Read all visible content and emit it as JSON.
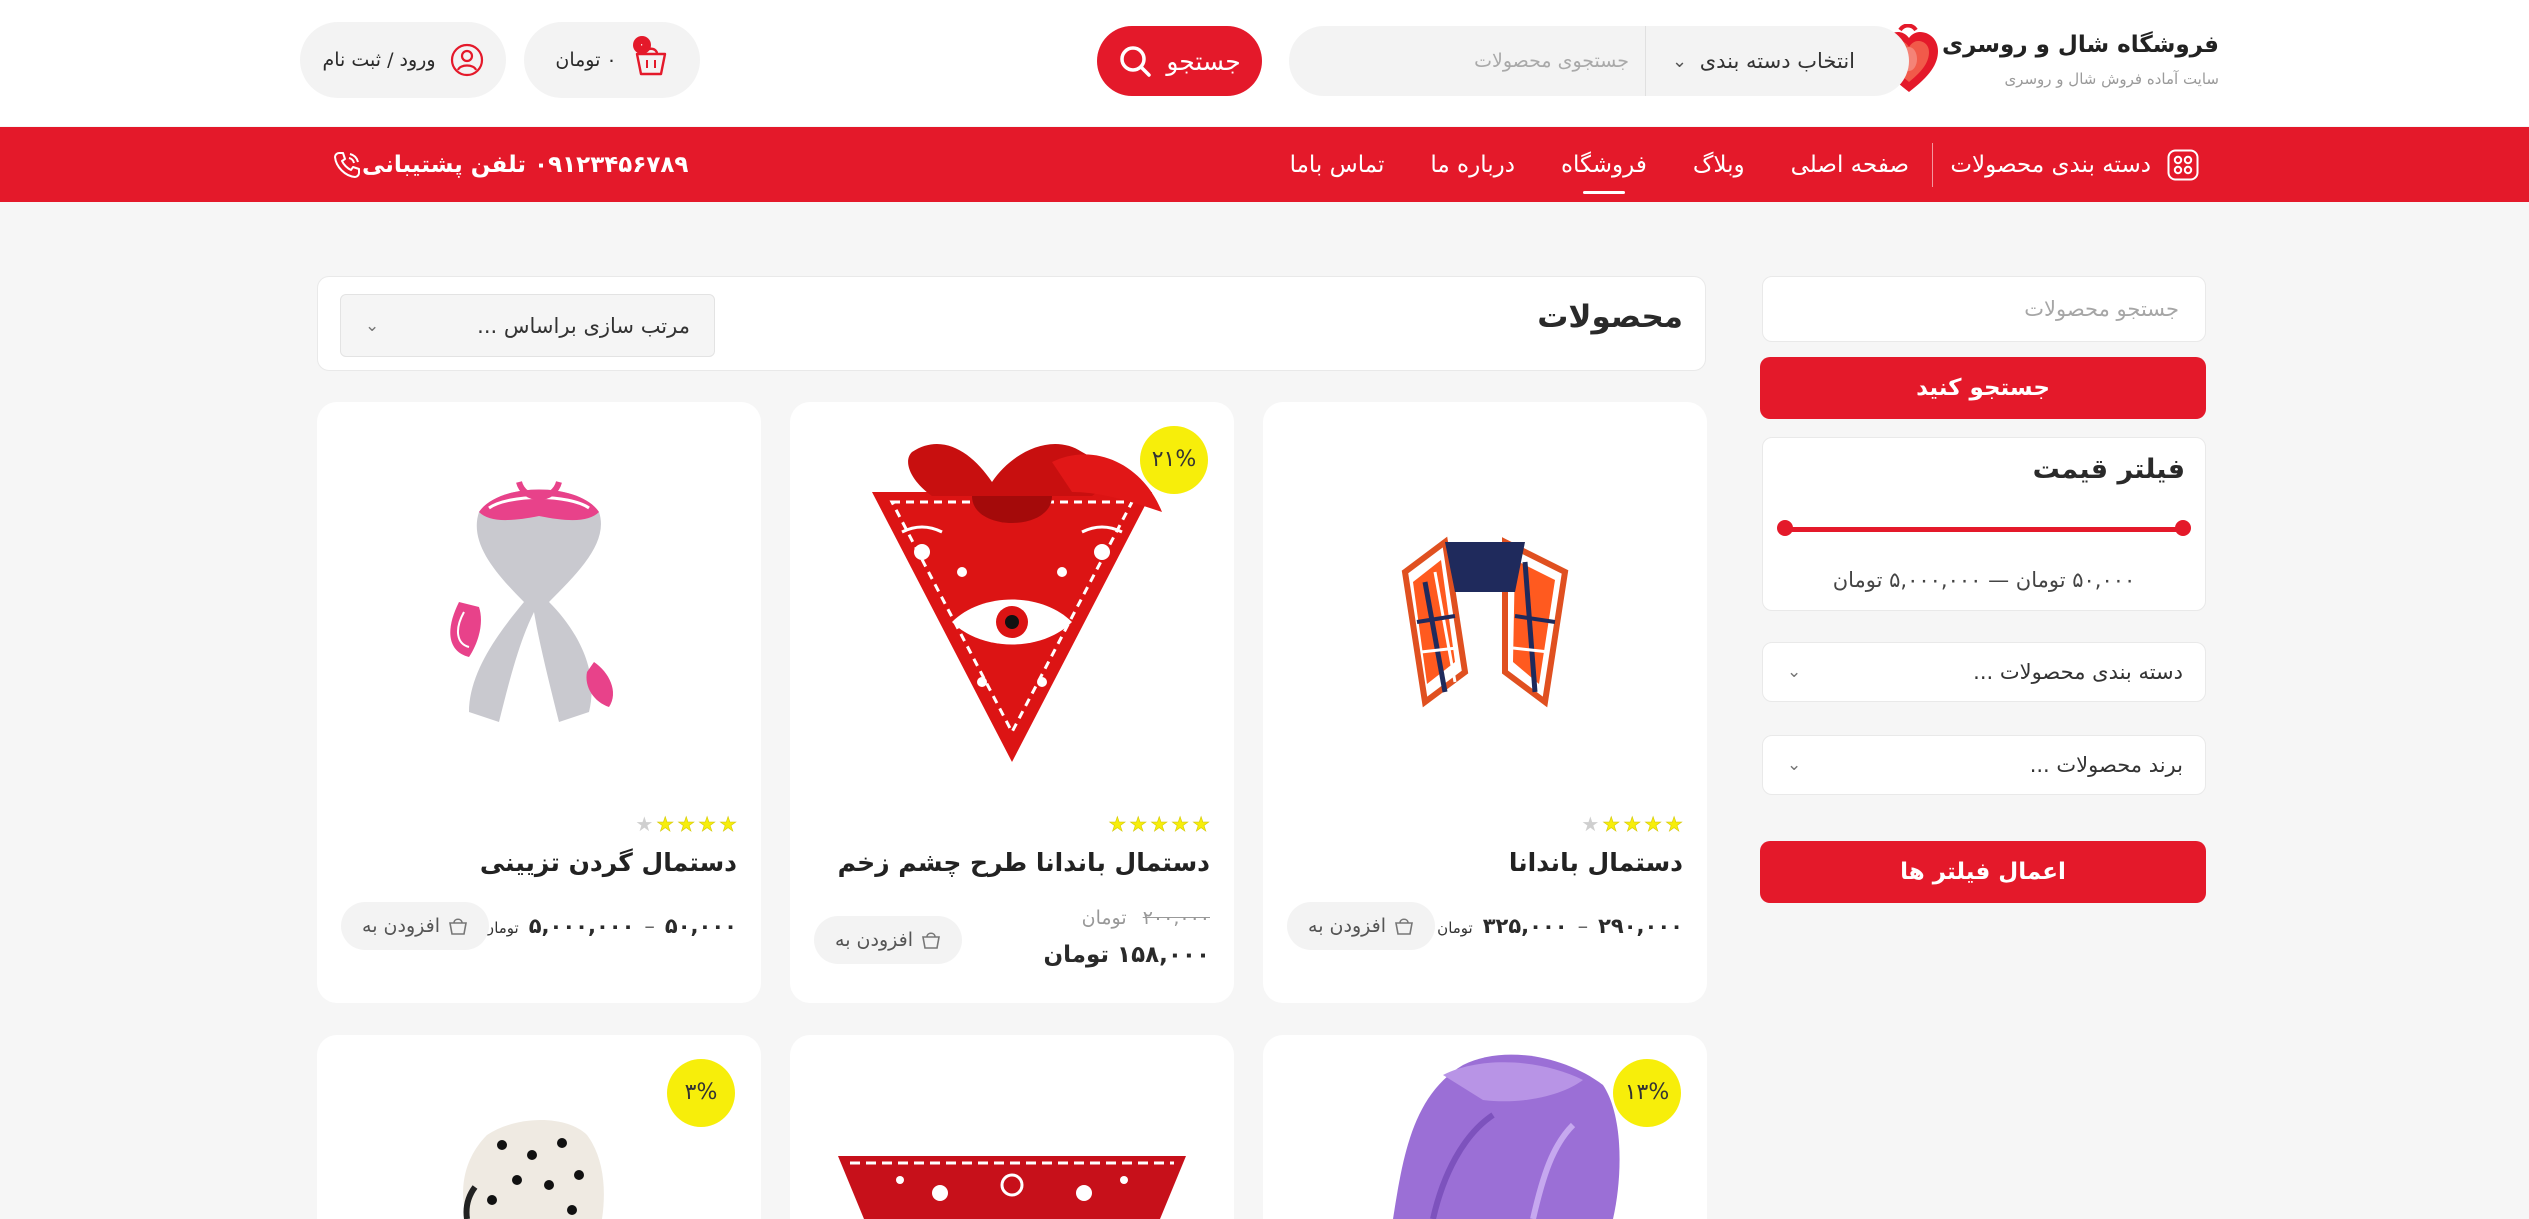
{
  "header": {
    "store_name": "فروشگاه شال و روسری",
    "store_tagline": "سایت آماده فروش شال و روسری",
    "category_select": "انتخاب دسته بندی",
    "search_placeholder": "جستجوی محصولات",
    "search_button": "جستجو",
    "cart_badge": "۰",
    "cart_total": "۰ تومان",
    "login_label": "ورود / ثبت نام"
  },
  "nav": {
    "categories_label": "دسته بندی محصولات",
    "links": [
      "صفحه اصلی",
      "وبلاگ",
      "فروشگاه",
      "درباره ما",
      "تماس باما"
    ],
    "active_link": "فروشگاه",
    "support_phone": "۰۹۱۲۳۴۵۶۷۸۹ تلفن پشتیبانی"
  },
  "sidebar": {
    "search_placeholder": "جستجو محصولات",
    "search_button": "جستجو کنید",
    "price_filter_title": "فیلتر قیمت",
    "price_range_text": "۵۰,۰۰۰ تومان — ۵,۰۰۰,۰۰۰ تومان",
    "category_dropdown": "دسته بندی محصولات ...",
    "brand_dropdown": "برند محصولات ...",
    "apply_button": "اعمال فیلتر ها"
  },
  "main": {
    "title": "محصولات",
    "sort_label": "مرتب سازی براساس ...",
    "products": [
      {
        "name": "دستمال باندانا",
        "rating": 4,
        "price_min": "۲۹۰,۰۰۰",
        "price_max": "۳۲۵,۰۰۰",
        "unit": "تومان",
        "add_label": "افزودن به"
      },
      {
        "name": "دستمال باندانا طرح چشم زخم",
        "rating": 5,
        "discount": "۲۱%",
        "old_price": "۲۰۰,۰۰۰",
        "old_unit": "تومان",
        "new_price": "۱۵۸,۰۰۰ تومان",
        "add_label": "افزودن به"
      },
      {
        "name": "دستمال گردن تزیینی",
        "rating": 4,
        "price_min": "۵۰,۰۰۰",
        "price_max": "۵,۰۰۰,۰۰۰",
        "unit": "تومان",
        "add_label": "افزودن به"
      }
    ],
    "row2_badges": [
      "۱۳%",
      "۳%"
    ]
  },
  "colors": {
    "brand_red": "#e4192a",
    "badge_yellow": "#f7ee0a"
  },
  "icons": [
    "heart-logo-icon",
    "search-icon",
    "chevron-down-icon",
    "cart-icon",
    "user-icon",
    "category-grid-icon",
    "phone-icon",
    "star-icon"
  ]
}
